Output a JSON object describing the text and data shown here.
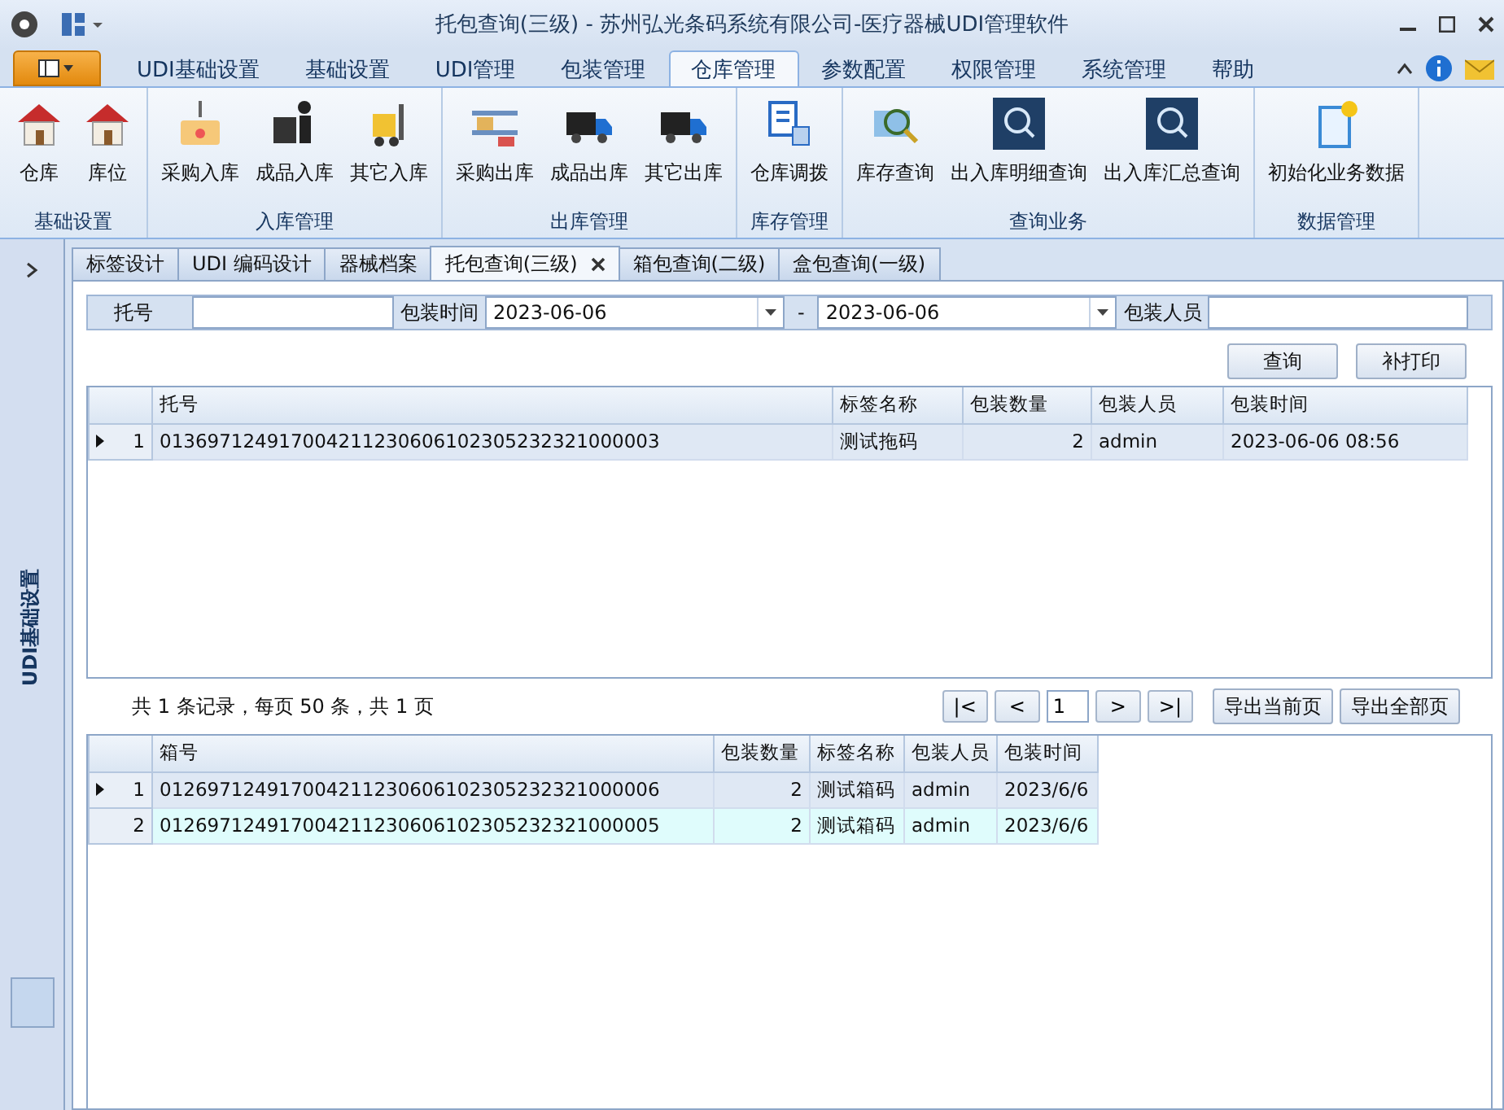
{
  "window": {
    "title": "托包查询(三级) - 苏州弘光条码系统有限公司-医疗器械UDI管理软件"
  },
  "ribbon_tabs": [
    {
      "label": "UDI基础设置",
      "selected": false
    },
    {
      "label": "基础设置",
      "selected": false
    },
    {
      "label": "UDI管理",
      "selected": false
    },
    {
      "label": "包装管理",
      "selected": false
    },
    {
      "label": "仓库管理",
      "selected": true
    },
    {
      "label": "参数配置",
      "selected": false
    },
    {
      "label": "权限管理",
      "selected": false
    },
    {
      "label": "系统管理",
      "selected": false
    },
    {
      "label": "帮助",
      "selected": false
    }
  ],
  "ribbon_groups": [
    {
      "label": "基础设置",
      "buttons": [
        {
          "label": "仓库",
          "kind": "house"
        },
        {
          "label": "库位",
          "kind": "house"
        }
      ]
    },
    {
      "label": "入库管理",
      "buttons": [
        {
          "label": "采购入库",
          "kind": "crate"
        },
        {
          "label": "成品入库",
          "kind": "worker"
        },
        {
          "label": "其它入库",
          "kind": "forklift"
        }
      ]
    },
    {
      "label": "出库管理",
      "buttons": [
        {
          "label": "采购出库",
          "kind": "shelf"
        },
        {
          "label": "成品出库",
          "kind": "truck"
        },
        {
          "label": "其它出库",
          "kind": "truck"
        }
      ]
    },
    {
      "label": "库存管理",
      "buttons": [
        {
          "label": "仓库调拨",
          "kind": "transfer"
        }
      ]
    },
    {
      "label": "查询业务",
      "buttons": [
        {
          "label": "库存查询",
          "kind": "magnifier"
        },
        {
          "label": "出入库明细查询",
          "kind": "search"
        },
        {
          "label": "出入库汇总查询",
          "kind": "search"
        }
      ]
    },
    {
      "label": "数据管理",
      "buttons": [
        {
          "label": "初始化业务数据",
          "kind": "document"
        }
      ]
    }
  ],
  "side_panel": {
    "label": "UDI基础设置"
  },
  "doc_tabs": [
    {
      "label": "标签设计",
      "selected": false
    },
    {
      "label": "UDI 编码设计",
      "selected": false
    },
    {
      "label": "器械档案",
      "selected": false
    },
    {
      "label": "托包查询(三级)",
      "selected": true
    },
    {
      "label": "箱包查询(二级)",
      "selected": false
    },
    {
      "label": "盒包查询(一级)",
      "selected": false
    }
  ],
  "filter": {
    "pallet_label": "托号",
    "time_label": "包装时间",
    "date_from": "2023-06-06",
    "separator": "-",
    "date_to": "2023-06-06",
    "packer_label": "包装人员"
  },
  "actions": [
    "查询",
    "补打印"
  ],
  "pallet_grid": {
    "columns": [
      {
        "label": "托号",
        "kind": "text"
      },
      {
        "label": "标签名称",
        "kind": "text"
      },
      {
        "label": "包装数量",
        "kind": "number"
      },
      {
        "label": "包装人员",
        "kind": "text"
      },
      {
        "label": "包装时间",
        "kind": "text"
      }
    ],
    "rows": [
      {
        "number": "1",
        "current": true,
        "cells": [
          "013697124917004211230606102305232321000003",
          "测试拖码",
          "2",
          "admin",
          "2023-06-06 08:56"
        ]
      }
    ]
  },
  "pager": {
    "summary": "共 1 条记录，每页 50 条，共 1 页",
    "first": "|<",
    "prev": "<",
    "page": "1",
    "next": ">",
    "last": ">|",
    "exports": [
      "导出当前页",
      "导出全部页"
    ]
  },
  "box_grid": {
    "columns": [
      {
        "label": "箱号",
        "kind": "text"
      },
      {
        "label": "包装数量",
        "kind": "number"
      },
      {
        "label": "标签名称",
        "kind": "text"
      },
      {
        "label": "包装人员",
        "kind": "text"
      },
      {
        "label": "包装时间",
        "kind": "text"
      }
    ],
    "rows": [
      {
        "number": "1",
        "current": true,
        "cells": [
          "012697124917004211230606102305232321000006",
          "2",
          "测试箱码",
          "admin",
          "2023/6/6"
        ]
      },
      {
        "number": "2",
        "current": false,
        "cells": [
          "012697124917004211230606102305232321000005",
          "2",
          "测试箱码",
          "admin",
          "2023/6/6"
        ]
      }
    ]
  }
}
